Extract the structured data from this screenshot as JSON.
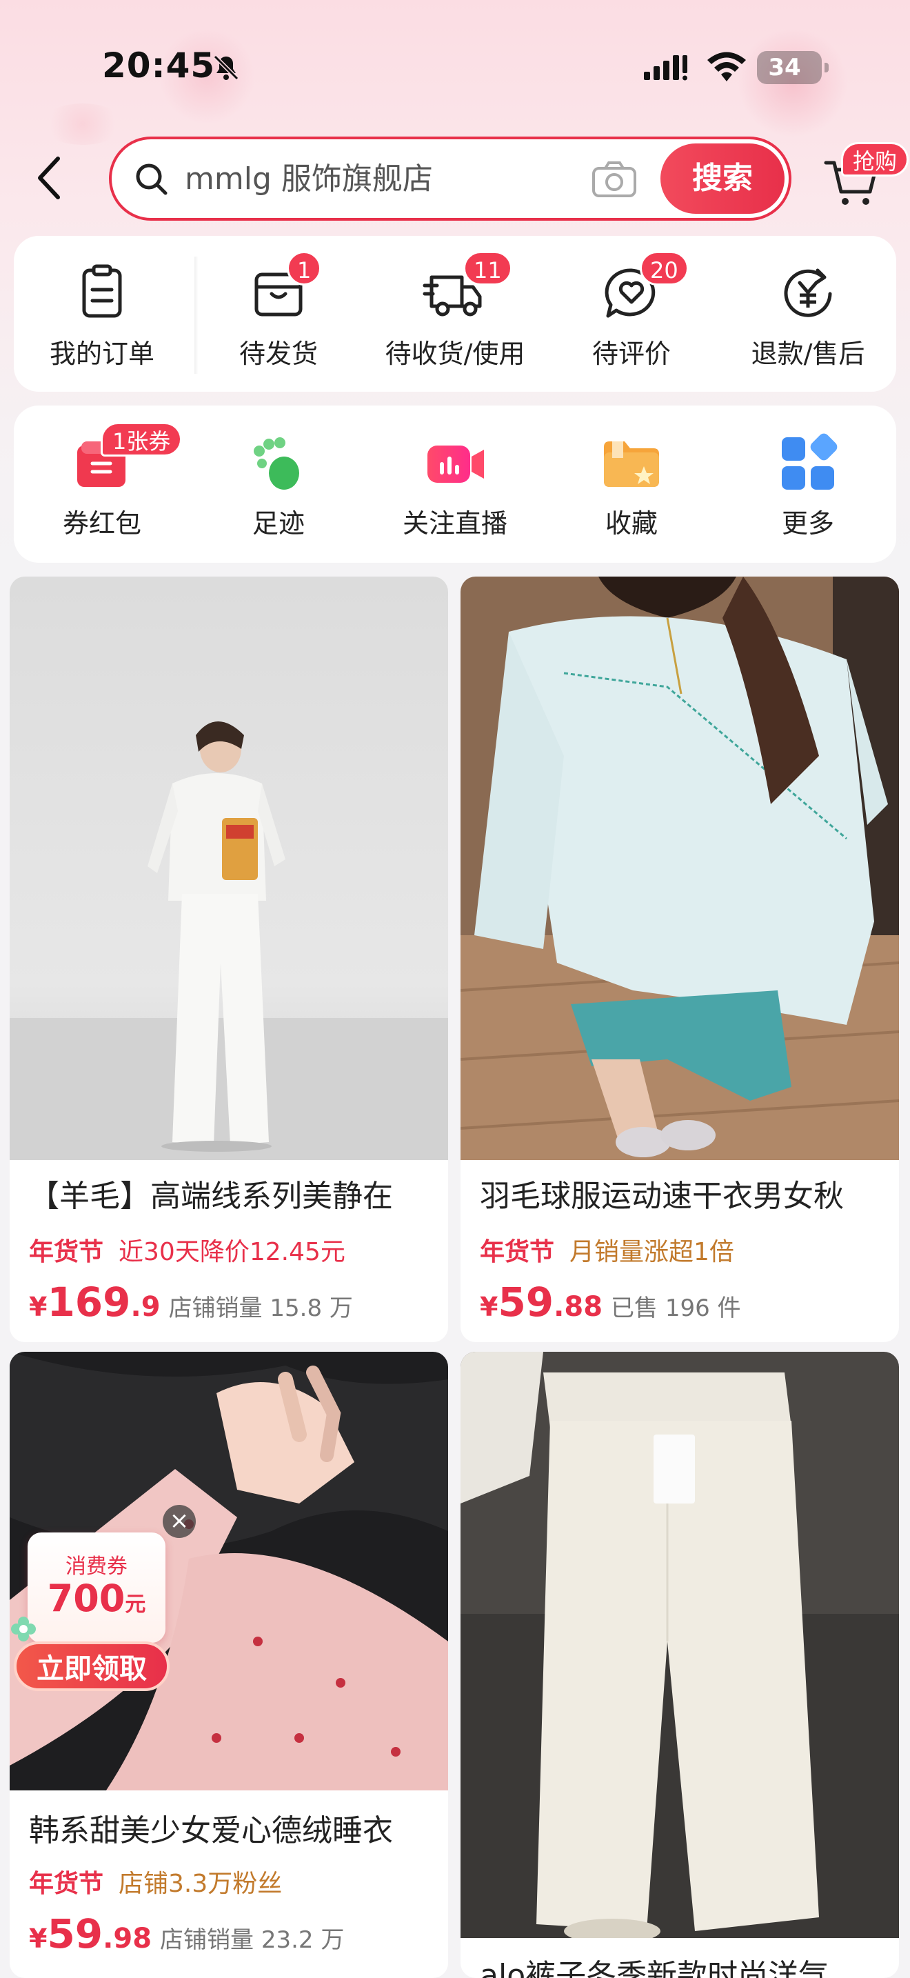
{
  "status_bar": {
    "time": "20:45",
    "battery": "34"
  },
  "header": {
    "search_text": "mmlg 服饰旗舰店",
    "search_button": "搜索",
    "cart_badge": "抢购"
  },
  "order_panel": [
    {
      "label": "我的订单",
      "icon": "order-list-icon",
      "badge": ""
    },
    {
      "label": "待发货",
      "icon": "package-icon",
      "badge": "1"
    },
    {
      "label": "待收货/使用",
      "icon": "delivery-truck-icon",
      "badge": "11"
    },
    {
      "label": "待评价",
      "icon": "heart-comment-icon",
      "badge": "20"
    },
    {
      "label": "退款/售后",
      "icon": "refund-yen-icon",
      "badge": ""
    }
  ],
  "quick_panel": [
    {
      "label": "券红包",
      "icon": "coupon-redpacket-icon",
      "badge": "1张券"
    },
    {
      "label": "足迹",
      "icon": "footprint-icon",
      "badge": ""
    },
    {
      "label": "关注直播",
      "icon": "live-camera-icon",
      "badge": ""
    },
    {
      "label": "收藏",
      "icon": "favorite-folder-icon",
      "badge": ""
    },
    {
      "label": "更多",
      "icon": "more-grid-icon",
      "badge": ""
    }
  ],
  "products": [
    {
      "title": "【羊毛】高端线系列美静在",
      "tag": "年货节",
      "sub": "近30天降价12.45元",
      "price_int": "169",
      "price_dec": ".9",
      "sales": "店铺销量 15.8 万"
    },
    {
      "title": "羽毛球服运动速干衣男女秋",
      "tag": "年货节",
      "sub": "月销量涨超1倍",
      "price_int": "59",
      "price_dec": ".88",
      "sales": "已售 196 件"
    },
    {
      "title": "韩系甜美少女爱心德绒睡衣",
      "tag": "年货节",
      "sub": "店铺3.3万粉丝",
      "price_int": "59",
      "price_dec": ".98",
      "sales": "店铺销量 23.2 万"
    },
    {
      "title": "alo裤子冬季新款时尚洋气"
    }
  ],
  "currency": "¥",
  "coupon_popup": {
    "title": "消费券",
    "value": "700",
    "unit": "元",
    "button": "立即领取",
    "close": "×"
  },
  "colors": {
    "accent": "#e8304a",
    "gold": "#c27a2c"
  }
}
